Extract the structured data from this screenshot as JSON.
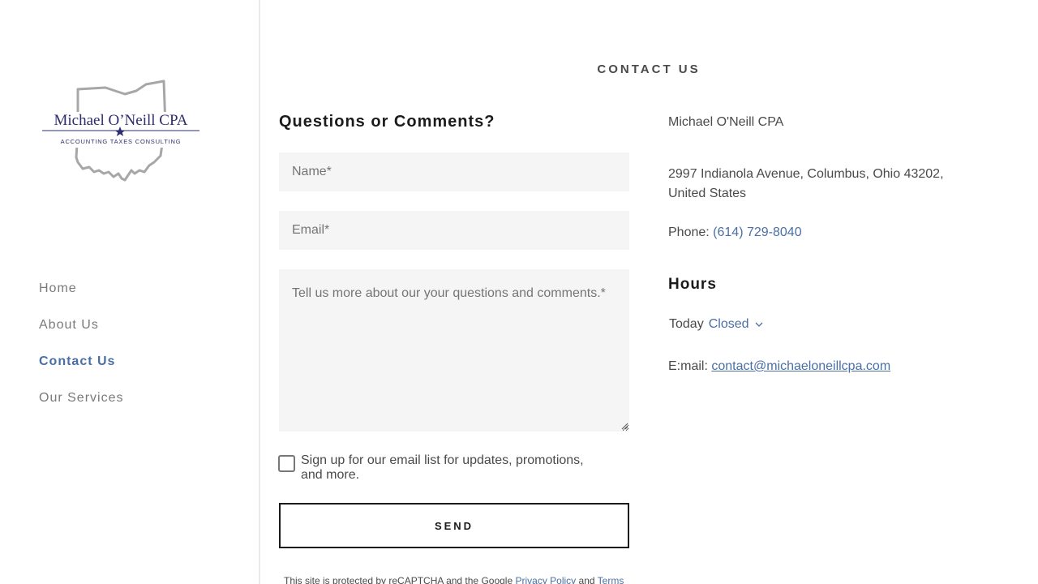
{
  "logo": {
    "name": "Michael O’Neill CPA",
    "tagline": "ACCOUNTING TAXES CONSULTING"
  },
  "nav": {
    "items": [
      {
        "label": "Home",
        "active": false
      },
      {
        "label": "About Us",
        "active": false
      },
      {
        "label": "Contact Us",
        "active": true
      },
      {
        "label": "Our Services",
        "active": false
      }
    ]
  },
  "section": {
    "title": "CONTACT US"
  },
  "form": {
    "heading": "Questions or Comments?",
    "name_placeholder": "Name*",
    "email_placeholder": "Email*",
    "message_placeholder": "Tell us more about our your questions and comments.*",
    "signup_label": "Sign up for our email list for updates, promotions, and more.",
    "signup_checked": false,
    "send_label": "SEND",
    "recaptcha_prefix": "This site is protected by reCAPTCHA and the Google",
    "privacy_link": "Privacy Policy",
    "recaptcha_and": "and",
    "terms_link": "Terms"
  },
  "contact": {
    "company": "Michael O'Neill CPA",
    "address": "2997 Indianola Avenue, Columbus, Ohio 43202, United States",
    "phone_label": "Phone:",
    "phone": "(614) 729-8040",
    "hours_heading": "Hours",
    "today_label": "Today",
    "today_status": "Closed",
    "email_label": "E:mail:",
    "email": "contact@michaeloneillcpa.com"
  },
  "colors": {
    "accent": "#4a6fa5",
    "logo_navy": "#2e2c6e",
    "border": "#ebebeb",
    "field_bg": "#f5f5f5"
  },
  "icons": {
    "logo_outline": "ohio-state-outline-icon",
    "logo_star": "star-icon",
    "hours_toggle": "chevron-down-icon"
  }
}
